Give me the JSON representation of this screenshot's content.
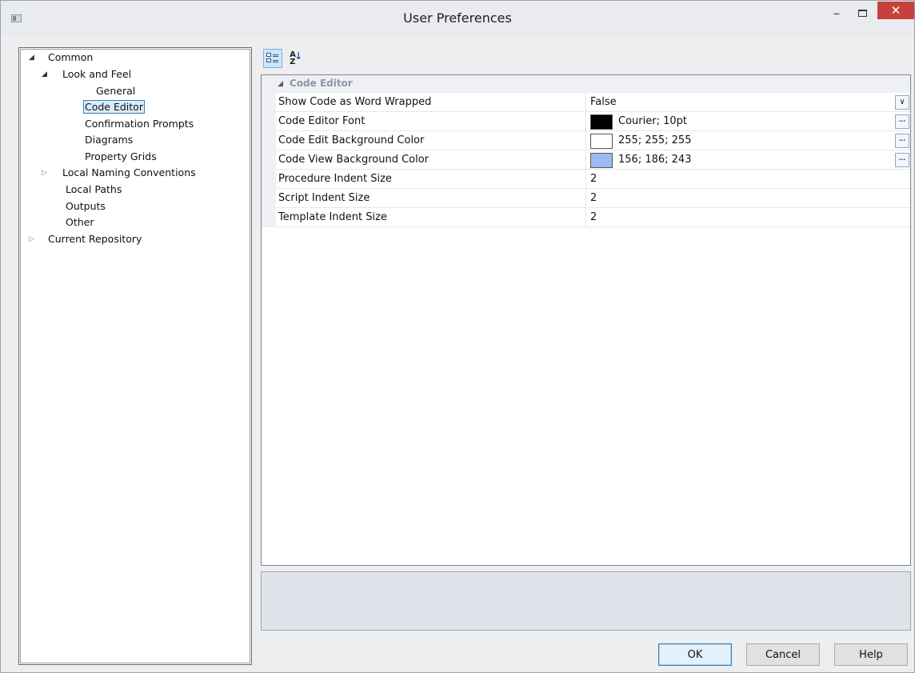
{
  "window": {
    "title": "User Preferences",
    "minimize_glyph": "–",
    "close_glyph": "✕"
  },
  "tree": {
    "common": "Common",
    "look_and_feel": "Look and Feel",
    "general": "General",
    "code_editor": "Code Editor",
    "confirmation_prompts": "Confirmation Prompts",
    "diagrams": "Diagrams",
    "property_grids": "Property Grids",
    "local_naming_conventions": "Local Naming Conventions",
    "local_paths": "Local Paths",
    "outputs": "Outputs",
    "other": "Other",
    "current_repository": "Current Repository",
    "selected": "Code Editor"
  },
  "toolbar": {
    "categorized_icon": "categorized-icon",
    "alphabetical_icon": "sort-az-icon",
    "az_glyph_a": "A",
    "az_glyph_z": "Z",
    "az_arrow": "↓"
  },
  "grid": {
    "category": "Code Editor",
    "rows": [
      {
        "name": "Show Code as Word Wrapped",
        "value": "False",
        "editor": "dropdown"
      },
      {
        "name": "Code Editor Font",
        "value": "Courier; 10pt",
        "swatch": "#000000",
        "editor": "dialog"
      },
      {
        "name": "Code Edit Background Color",
        "value": "255; 255; 255",
        "swatch": "#ffffff",
        "editor": "dialog"
      },
      {
        "name": "Code View Background Color",
        "value": "156; 186; 243",
        "swatch": "#9cbaf3",
        "editor": "dialog"
      },
      {
        "name": "Procedure Indent Size",
        "value": "2"
      },
      {
        "name": "Script Indent Size",
        "value": "2"
      },
      {
        "name": "Template Indent Size",
        "value": "2"
      }
    ],
    "dropdown_glyph": "∨",
    "dialog_glyph": "..."
  },
  "buttons": {
    "ok": "OK",
    "cancel": "Cancel",
    "help": "Help"
  },
  "colors": {
    "selection_border": "#3c7fb1",
    "selection_fill": "#d9ecfb",
    "close_button": "#c7413a"
  }
}
